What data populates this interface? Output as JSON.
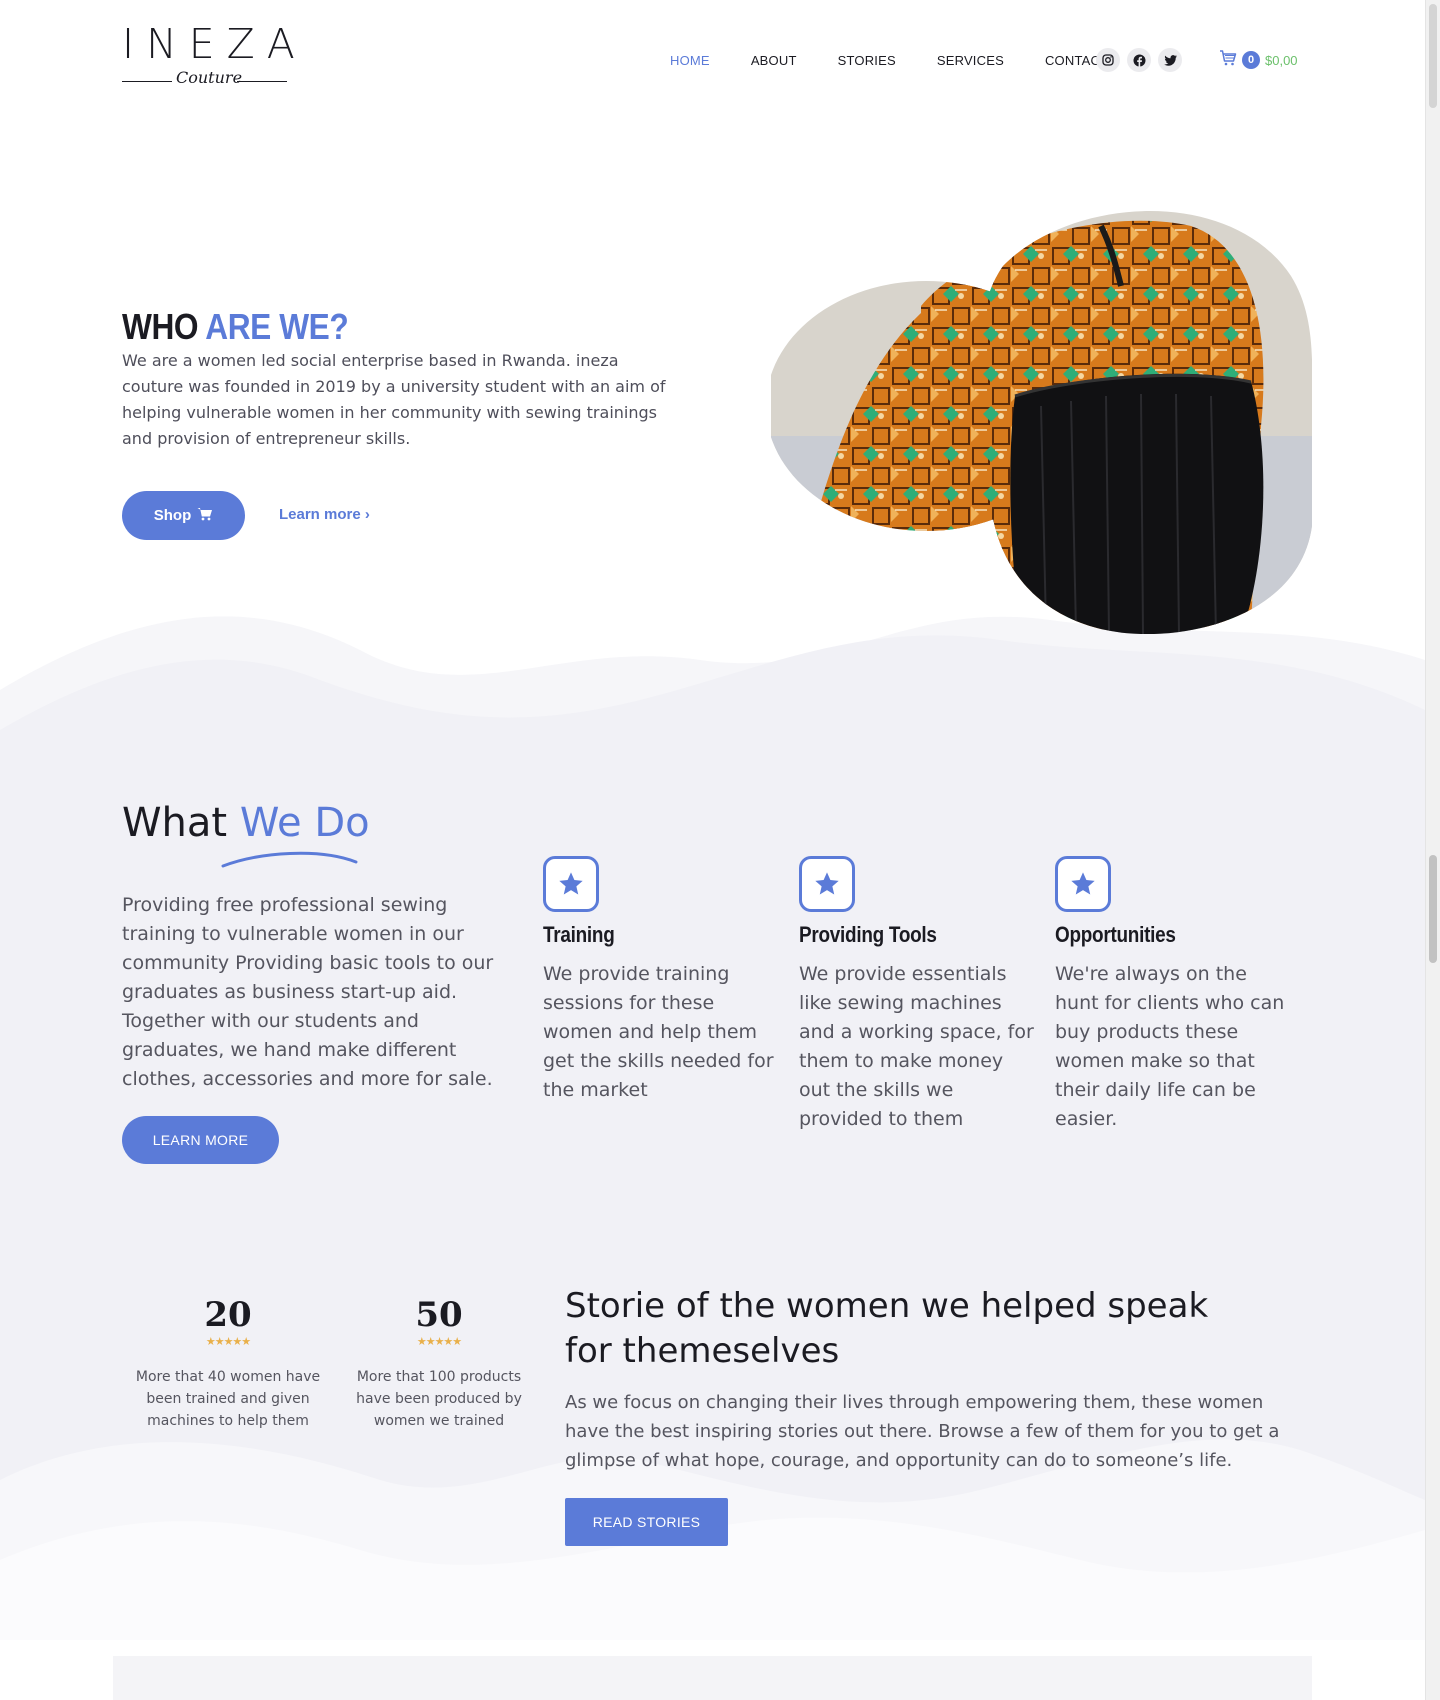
{
  "brand": {
    "name": "INEZA",
    "tagline": "Couture"
  },
  "nav": {
    "home": "HOME",
    "about": "ABOUT",
    "stories": "STORIES",
    "services": "SERVICES",
    "contact": "CONTACT"
  },
  "social": [
    "instagram-icon",
    "facebook-icon",
    "twitter-icon"
  ],
  "cart": {
    "count": "0",
    "amount": "$0,00"
  },
  "hero": {
    "title_a": "WHO",
    "title_b": "ARE WE?",
    "text": "We are a women led social enterprise based in Rwanda. ineza couture was founded in 2019 by a university student with an aim of helping vulnerable women in her community with  sewing trainings and provision of entrepreneur skills.",
    "shop_label": "Shop",
    "learn_label": "Learn more"
  },
  "what_we_do": {
    "title_a": "What",
    "title_b": "We Do",
    "text": "Providing free professional sewing training to vulnerable women in our community Providing basic tools to our graduates as business start-up aid. Together with our students and graduates, we hand make different clothes, accessories and more for sale.",
    "button": "LEARN MORE",
    "features": [
      {
        "title": "Training",
        "text": "We provide training sessions for these women and help them get the skills needed for the market"
      },
      {
        "title": "Providing Tools",
        "text": "We provide essentials like sewing machines and a working space, for them to make money out the skills we provided to them"
      },
      {
        "title": "Opportunities",
        "text": "We're always on the hunt for clients who can buy products these women make so that their daily life can be easier."
      }
    ]
  },
  "stats": [
    {
      "number": "20",
      "stars": "★★★★★",
      "caption": "More that 40 women have been trained and given machines to help them"
    },
    {
      "number": "50",
      "stars": "★★★★★",
      "caption": "More that 100 products have been produced by women we trained"
    }
  ],
  "stories": {
    "title": "Storie of the women we helped speak for themeselves",
    "text": "As we focus on changing their lives through empowering them, these women have the best inspiring stories out there. Browse a few of them for you to get a glimpse of what hope, courage, and opportunity can do to someone’s life.",
    "button": "READ STORIES"
  },
  "colors": {
    "accent": "#5b7bd8",
    "band": "#f1f1f6",
    "cart_amount": "#6bc06b",
    "star": "#e9b04a"
  }
}
